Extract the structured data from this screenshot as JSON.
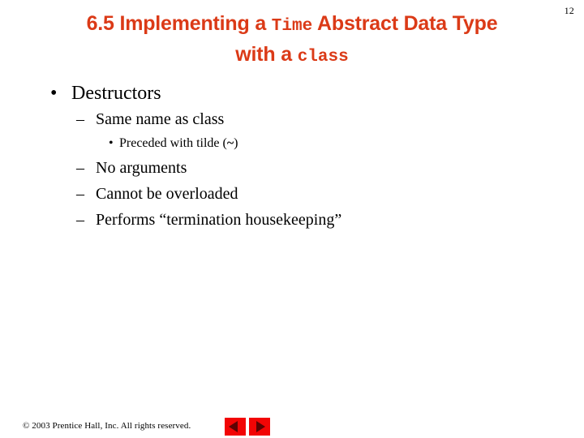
{
  "slide": {
    "page_number": "12",
    "title": {
      "line1_part1": "6.5 Implementing a ",
      "line1_mono": "Time",
      "line1_part2": " Abstract Data Type",
      "line2_part1": "with a ",
      "line2_mono": "class",
      "color": "#DB3A17"
    },
    "outline": [
      {
        "level": 1,
        "marker": "•",
        "text": "Destructors"
      },
      {
        "level": 2,
        "marker": "–",
        "text": "Same name as class"
      },
      {
        "level": 3,
        "marker": "•",
        "text_before": "Preceded with tilde (",
        "tilde": "~",
        "text_after": ")"
      },
      {
        "level": 2,
        "marker": "–",
        "text": "No arguments"
      },
      {
        "level": 2,
        "marker": "–",
        "text": "Cannot be overloaded"
      },
      {
        "level": 2,
        "marker": "–",
        "text": "Performs “termination housekeeping”"
      }
    ],
    "footer": {
      "copyright": "© 2003 Prentice Hall, Inc.  All rights reserved.",
      "prev_label": "Previous slide",
      "next_label": "Next slide",
      "button_color": "#F20505"
    }
  }
}
